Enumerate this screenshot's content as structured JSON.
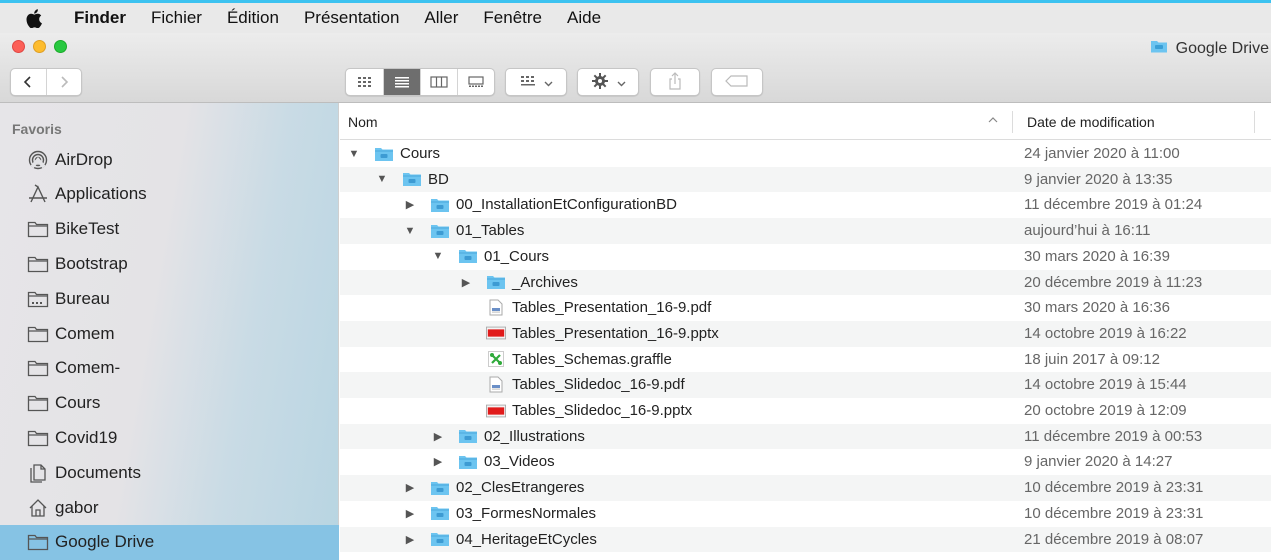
{
  "menubar": {
    "apple_icon": "apple-icon",
    "items": [
      "Finder",
      "Fichier",
      "Édition",
      "Présentation",
      "Aller",
      "Fenêtre",
      "Aide"
    ]
  },
  "window": {
    "title": "Google Drive",
    "title_icon": "folder-icon"
  },
  "toolbar": {
    "back_icon": "chevron-left-icon",
    "forward_icon": "chevron-right-icon",
    "view_icons": [
      "icon-view-icon",
      "list-view-icon",
      "column-view-icon",
      "gallery-view-icon"
    ],
    "selected_view": "list",
    "group_icon": "group-icon",
    "action_icon": "gear-icon",
    "share_icon": "share-icon",
    "tag_icon": "tag-icon"
  },
  "sidebar": {
    "header": "Favoris",
    "items": [
      {
        "label": "AirDrop",
        "icon": "airdrop-icon"
      },
      {
        "label": "Applications",
        "icon": "applications-icon"
      },
      {
        "label": "BikeTest",
        "icon": "folder-icon"
      },
      {
        "label": "Bootstrap",
        "icon": "folder-icon"
      },
      {
        "label": "Bureau",
        "icon": "desktop-icon"
      },
      {
        "label": "Comem",
        "icon": "folder-icon"
      },
      {
        "label": "Comem-",
        "icon": "folder-icon"
      },
      {
        "label": "Cours",
        "icon": "folder-icon"
      },
      {
        "label": "Covid19",
        "icon": "folder-icon"
      },
      {
        "label": "Documents",
        "icon": "documents-icon"
      },
      {
        "label": "gabor",
        "icon": "home-icon"
      },
      {
        "label": "Google Drive",
        "icon": "folder-icon",
        "selected": true
      }
    ]
  },
  "list": {
    "columns": {
      "name": "Nom",
      "date": "Date de modification"
    },
    "rows": [
      {
        "name": "Cours",
        "date": "24 janvier 2020 à 11:00",
        "level": 0,
        "expanded": true,
        "kind": "folder"
      },
      {
        "name": "BD",
        "date": "9 janvier 2020 à 13:35",
        "level": 1,
        "expanded": true,
        "kind": "folder"
      },
      {
        "name": "00_InstallationEtConfigurationBD",
        "date": "11 décembre 2019 à 01:24",
        "level": 2,
        "expanded": false,
        "kind": "folder"
      },
      {
        "name": "01_Tables",
        "date": "aujourd’hui à 16:11",
        "level": 2,
        "expanded": true,
        "kind": "folder"
      },
      {
        "name": "01_Cours",
        "date": "30 mars 2020 à 16:39",
        "level": 3,
        "expanded": true,
        "kind": "folder"
      },
      {
        "name": "_Archives",
        "date": "20 décembre 2019 à 11:23",
        "level": 4,
        "expanded": false,
        "kind": "folder"
      },
      {
        "name": "Tables_Presentation_16-9.pdf",
        "date": "30 mars 2020 à 16:36",
        "level": 4,
        "kind": "pdf"
      },
      {
        "name": "Tables_Presentation_16-9.pptx",
        "date": "14 octobre 2019 à 16:22",
        "level": 4,
        "kind": "pptx"
      },
      {
        "name": "Tables_Schemas.graffle",
        "date": "18 juin 2017 à 09:12",
        "level": 4,
        "kind": "graffle"
      },
      {
        "name": "Tables_Slidedoc_16-9.pdf",
        "date": "14 octobre 2019 à 15:44",
        "level": 4,
        "kind": "pdf"
      },
      {
        "name": "Tables_Slidedoc_16-9.pptx",
        "date": "20 octobre 2019 à 12:09",
        "level": 4,
        "kind": "pptx"
      },
      {
        "name": "02_Illustrations",
        "date": "11 décembre 2019 à 00:53",
        "level": 3,
        "expanded": false,
        "kind": "folder"
      },
      {
        "name": "03_Videos",
        "date": "9 janvier 2020 à 14:27",
        "level": 3,
        "expanded": false,
        "kind": "folder"
      },
      {
        "name": "02_ClesEtrangeres",
        "date": "10 décembre 2019 à 23:31",
        "level": 2,
        "expanded": false,
        "kind": "folder"
      },
      {
        "name": "03_FormesNormales",
        "date": "10 décembre 2019 à 23:31",
        "level": 2,
        "expanded": false,
        "kind": "folder"
      },
      {
        "name": "04_HeritageEtCycles",
        "date": "21 décembre 2019 à 08:07",
        "level": 2,
        "expanded": false,
        "kind": "folder"
      }
    ]
  },
  "colors": {
    "selection": "#86c3e4",
    "folder": "#6cc4f0",
    "menubar_accent": "#3cc2f0"
  }
}
